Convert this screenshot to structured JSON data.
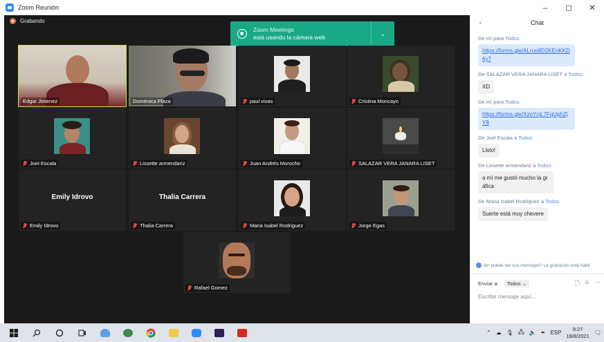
{
  "window": {
    "title": "Zoom Reunión",
    "controls": [
      "–",
      "◻",
      "✕"
    ]
  },
  "meeting": {
    "recording_label": "Grabando",
    "notification": {
      "line1": "Zoom Meetings",
      "line2": "está usando la cámara web",
      "chevron": "⌄"
    },
    "participants": [
      {
        "name": "Edgar Jimenez",
        "muted": false,
        "video": true,
        "active": true
      },
      {
        "name": "Doménica Plaza",
        "muted": false,
        "video": true
      },
      {
        "name": "paul vivas",
        "muted": true,
        "video": true
      },
      {
        "name": "Cristina Moncayo",
        "muted": true,
        "video": true
      },
      {
        "name": "Joel Escala",
        "muted": true,
        "video": true
      },
      {
        "name": "Lissette armendariz",
        "muted": true,
        "video": true
      },
      {
        "name": "Juan Andrés Morocho",
        "muted": true,
        "video": true
      },
      {
        "name": "SALAZAR VERA JANARA LISET",
        "muted": true,
        "video": true
      },
      {
        "name": "Emily Idrovo",
        "muted": true,
        "video": false
      },
      {
        "name": "Thalia Carrera",
        "muted": true,
        "video": false
      },
      {
        "name": "Maria Isabel Rodriguez",
        "muted": true,
        "video": true
      },
      {
        "name": "Jorge Egas",
        "muted": true,
        "video": true
      },
      {
        "name": "Rafael Gomez",
        "muted": true,
        "video": true
      }
    ]
  },
  "chat": {
    "title": "Chat",
    "collapse_icon": "⌄",
    "messages": [
      {
        "from_prefix": "De mí para",
        "from_to": "Todos:",
        "text": "https://forms.gle/ALruo8D2KEnKKD6y7",
        "type": "link"
      },
      {
        "from_prefix": "De SALAZAR VERA JANARA LISET a",
        "from_to": "Todos:",
        "text": "XD",
        "type": "grey"
      },
      {
        "from_prefix": "De mí para",
        "from_to": "Todos:",
        "text": "https://forms.gle/XzoYcjL7FqUphZjY8",
        "type": "link"
      },
      {
        "from_prefix": "De Joel Escala a",
        "from_to": "Todos:",
        "text": "Listo!",
        "type": "grey"
      },
      {
        "from_prefix": "De Lissette armendariz a",
        "from_to": "Todos:",
        "text": "a mí me gustó mucho la gráfica",
        "type": "grey"
      },
      {
        "from_prefix": "De Maria Isabel Rodriguez a",
        "from_to": "Todos:",
        "text": "Suerte está muy chevere",
        "type": "grey"
      }
    ],
    "notice": "ién puede ver sus mensajes? La grabación está habil",
    "send_to_label": "Enviar a:",
    "send_to_value": "Todos ⌄",
    "input_placeholder": "Escribir mensaje aquí...",
    "tools": [
      "🗋",
      "☺",
      "···"
    ]
  },
  "taskbar": {
    "tray_chevron": "⌃",
    "language": "ESP",
    "time": "9:27",
    "date": "18/8/2021"
  }
}
